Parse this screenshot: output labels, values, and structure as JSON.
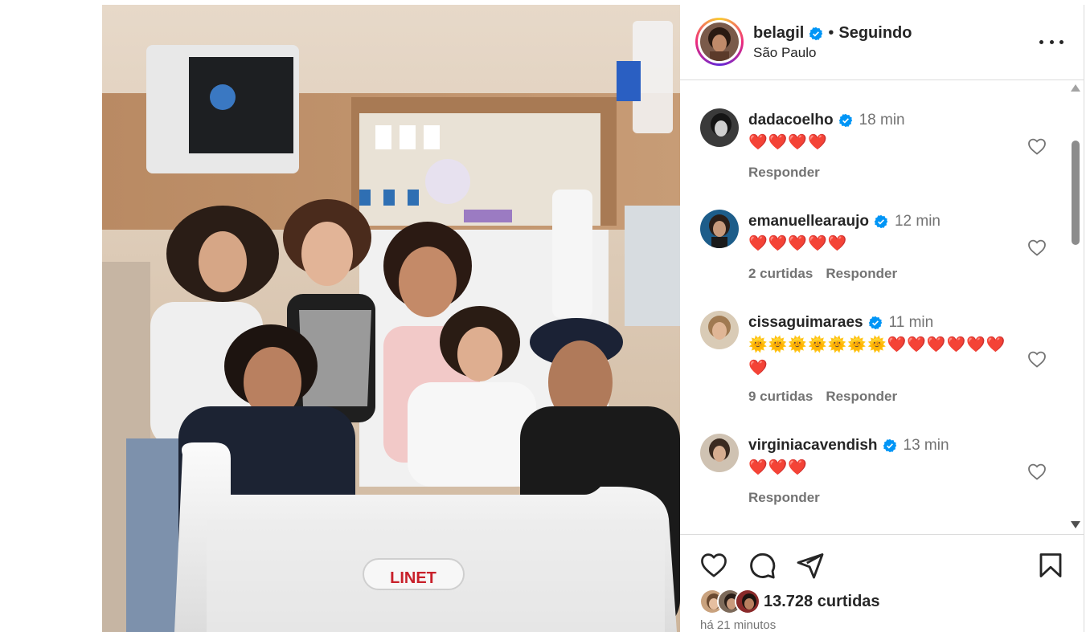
{
  "post": {
    "author": "belagil",
    "separator": "•",
    "follow_status": "Seguindo",
    "location": "São Paulo",
    "photo_text": "LINET"
  },
  "comments": [
    {
      "user": "dadacoelho",
      "time": "18 min",
      "text": "❤️❤️❤️❤️",
      "likes": "",
      "reply": "Responder"
    },
    {
      "user": "emanuellearaujo",
      "time": "12 min",
      "text": "❤️❤️❤️❤️❤️",
      "likes": "2 curtidas",
      "reply": "Responder"
    },
    {
      "user": "cissaguimaraes",
      "time": "11 min",
      "text": "🌞🌞🌞🌞🌞🌞🌞❤️❤️❤️❤️❤️❤️❤️",
      "likes": "9 curtidas",
      "reply": "Responder"
    },
    {
      "user": "virginiacavendish",
      "time": "13 min",
      "text": "❤️❤️❤️",
      "likes": "",
      "reply": "Responder"
    }
  ],
  "footer": {
    "likes": "13.728 curtidas",
    "time": "há 21 minutos"
  },
  "icons": {
    "verified": "verified-badge-icon",
    "more": "more-options-icon",
    "like": "heart-icon",
    "comment": "comment-icon",
    "share": "share-icon",
    "save": "bookmark-icon"
  },
  "colors": {
    "verified": "#0095f6",
    "heart": "#ed4956",
    "secondary_text": "#737373",
    "divider": "#dbdbdb"
  }
}
